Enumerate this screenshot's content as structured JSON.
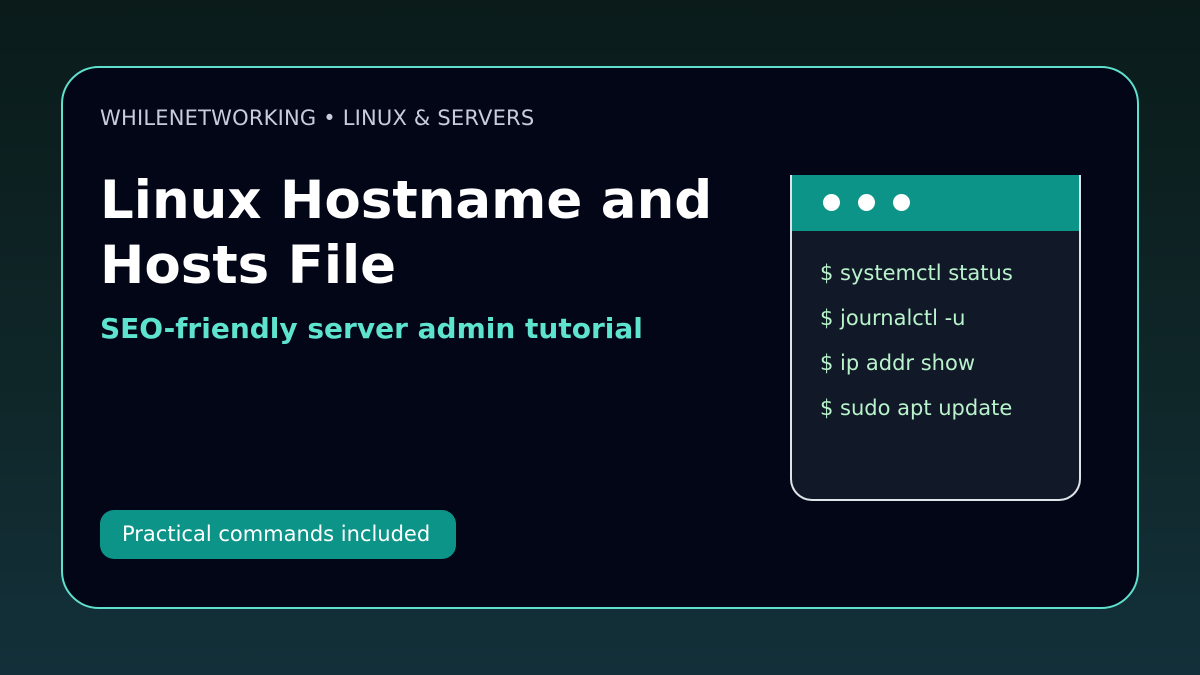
{
  "card": {
    "eyebrow": "WHILENETWORKING • LINUX & SERVERS",
    "title": "Linux Hostname and Hosts File",
    "subtitle": "SEO-friendly server admin tutorial",
    "badge": "Practical commands included"
  },
  "terminal": {
    "window_dots": [
      "window-dot",
      "window-dot",
      "window-dot"
    ],
    "commands": [
      "$ systemctl status",
      "$ journalctl -u",
      "$ ip addr show",
      "$ sudo apt update"
    ]
  },
  "colors": {
    "accent": "#5ee0cc",
    "badge_bg": "#0d9488",
    "card_bg": "#030617",
    "terminal_bg": "#111827",
    "command_text": "#b9f3cc",
    "page_bg_top": "#0a1b1a",
    "page_bg_bottom": "#13303a"
  }
}
